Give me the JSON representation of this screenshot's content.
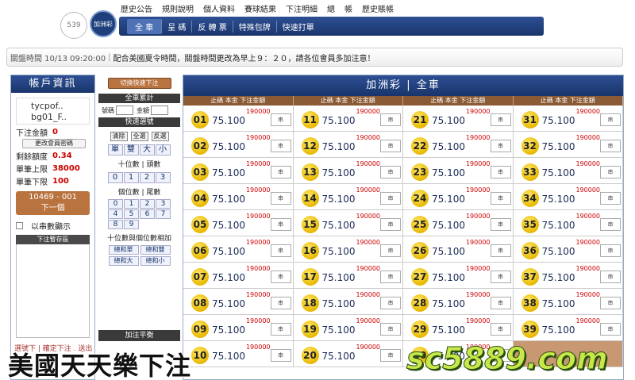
{
  "header": {
    "badge_left": "539",
    "badge_right": "加洲彩",
    "top_links": [
      "歷史公告",
      "規則說明",
      "個人資料",
      "賽球結果",
      "下注明細",
      "總",
      "帳",
      "歷史賬帳"
    ],
    "tabs": [
      "全 車",
      "呈 碼",
      "反 轉 票",
      "特殊包牌",
      "快速打單"
    ]
  },
  "notice": {
    "time": "關盤時間 10/13 09:20:00",
    "text": "配合美國夏令時間，關盤時間更改為早上９：２０，請各位會員多加注意！"
  },
  "account": {
    "title": "帳戶資訊",
    "user_line1": "tycpof..",
    "user_line2": "bg01_F..",
    "bet_amount_label": "下注金額",
    "bet_amount_value": "0",
    "change_password": "更改會員密碼",
    "rebate_label": "剩餘額度",
    "rebate_value": "0.34",
    "upper_limit_label": "單筆上限",
    "upper_limit_value": "38000",
    "lower_limit_label": "單筆下限",
    "lower_limit_value": "100",
    "next_code": "10469 - 001",
    "next_label": "下一個",
    "string_display": "以串數顯示",
    "temp_area": "下注暫存區",
    "footer_note": "選號下 | 確定下注 . 送出"
  },
  "quick": {
    "switch_button": "切換快速下注",
    "total_label": "全車累計",
    "count_label": "號碼",
    "amount_label": "金額",
    "quick_select": "快速選號",
    "clear": "清除",
    "select_all": "全選",
    "deselect": "反選",
    "odd_even": [
      "單",
      "雙",
      "大",
      "小"
    ],
    "tens_label": "十位數 | 頭數",
    "tens_digits": [
      "0",
      "1",
      "2",
      "3"
    ],
    "units_label": "個位數 | 尾數",
    "units_digits": [
      "0",
      "1",
      "2",
      "3",
      "4",
      "5",
      "6",
      "7",
      "8",
      "9"
    ],
    "combo_label": "十位數與個位數相加",
    "combo": [
      "總和單",
      "總和雙",
      "總和大",
      "總和小"
    ],
    "add_label": "加注平衡"
  },
  "main": {
    "title": "加洲彩 | 全車",
    "col_header": "止碼  本金  下注金額",
    "odds": "75.100",
    "limit": "190000",
    "input_placeholder": "串",
    "numbers": [
      "01",
      "11",
      "21",
      "31",
      "02",
      "12",
      "22",
      "32",
      "03",
      "13",
      "23",
      "33",
      "04",
      "14",
      "24",
      "34",
      "05",
      "15",
      "25",
      "35",
      "06",
      "16",
      "26",
      "36",
      "07",
      "17",
      "27",
      "37",
      "08",
      "18",
      "28",
      "38",
      "09",
      "19",
      "29",
      "39",
      "10",
      "20",
      "30",
      ""
    ]
  },
  "overlay": {
    "caption": "美國天天樂下注",
    "site": "sc5889.com"
  }
}
